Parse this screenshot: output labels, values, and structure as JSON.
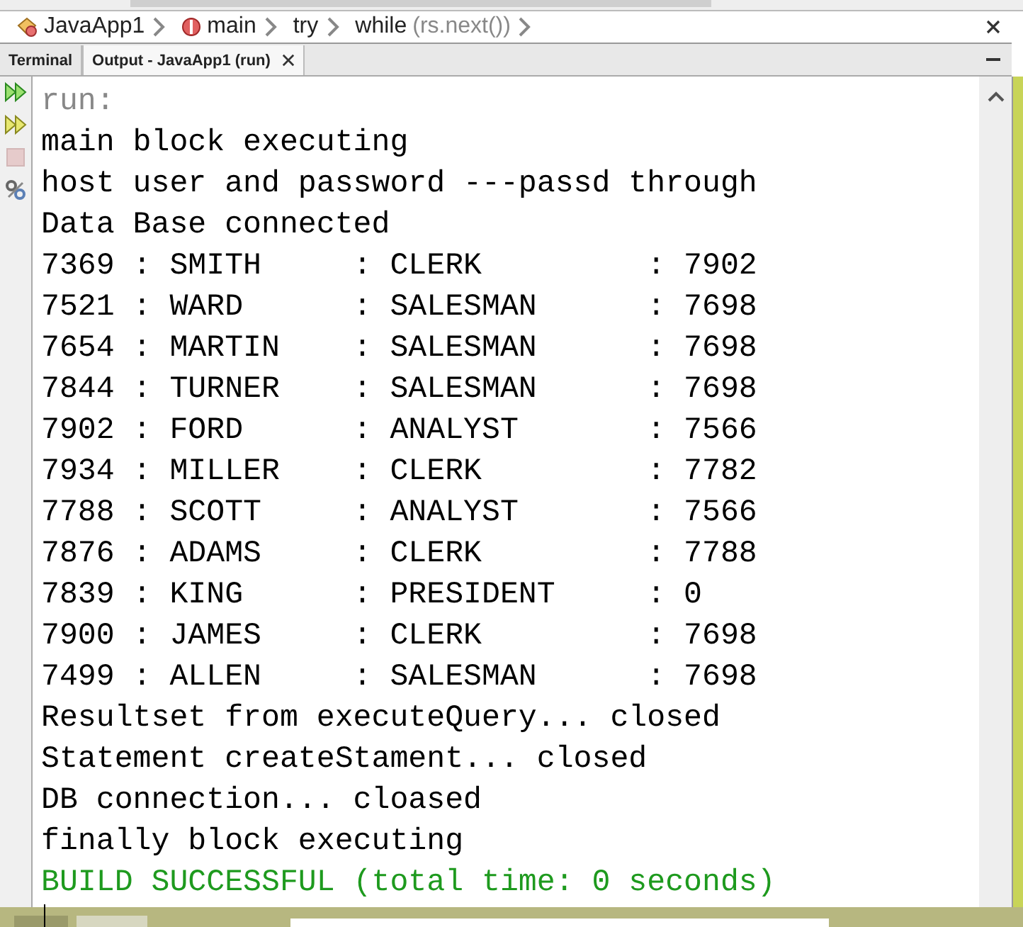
{
  "breadcrumbs": [
    {
      "kind": "project",
      "label": "JavaApp1"
    },
    {
      "kind": "method",
      "label": "main"
    },
    {
      "kind": "plain",
      "label": "try"
    },
    {
      "kind": "plain",
      "label": "while",
      "detail": "(rs.next())"
    }
  ],
  "tabs": [
    {
      "label": "Terminal",
      "selected": false,
      "closable": false
    },
    {
      "label": "Output - JavaApp1 (run)",
      "selected": true,
      "closable": true
    }
  ],
  "tools": [
    {
      "kind": "rerun",
      "disabled": false
    },
    {
      "kind": "rerun-with",
      "disabled": false
    },
    {
      "kind": "stop",
      "disabled": true
    },
    {
      "kind": "settings",
      "disabled": false
    }
  ],
  "output": [
    {
      "kind": "prompt",
      "text": "run:"
    },
    {
      "kind": "normal",
      "text": "main block executing"
    },
    {
      "kind": "normal",
      "text": "host user and password ---passd through"
    },
    {
      "kind": "normal",
      "text": "Data Base connected"
    },
    {
      "kind": "normal",
      "text": "7369 : SMITH     : CLERK         : 7902"
    },
    {
      "kind": "normal",
      "text": "7521 : WARD      : SALESMAN      : 7698"
    },
    {
      "kind": "normal",
      "text": "7654 : MARTIN    : SALESMAN      : 7698"
    },
    {
      "kind": "normal",
      "text": "7844 : TURNER    : SALESMAN      : 7698"
    },
    {
      "kind": "normal",
      "text": "7902 : FORD      : ANALYST       : 7566"
    },
    {
      "kind": "normal",
      "text": "7934 : MILLER    : CLERK         : 7782"
    },
    {
      "kind": "normal",
      "text": "7788 : SCOTT     : ANALYST       : 7566"
    },
    {
      "kind": "normal",
      "text": "7876 : ADAMS     : CLERK         : 7788"
    },
    {
      "kind": "normal",
      "text": "7839 : KING      : PRESIDENT     : 0"
    },
    {
      "kind": "normal",
      "text": "7900 : JAMES     : CLERK         : 7698"
    },
    {
      "kind": "normal",
      "text": "7499 : ALLEN     : SALESMAN      : 7698"
    },
    {
      "kind": "normal",
      "text": "Resultset from executeQuery... closed"
    },
    {
      "kind": "normal",
      "text": "Statement createStament... closed"
    },
    {
      "kind": "normal",
      "text": "DB connection... cloased"
    },
    {
      "kind": "normal",
      "text": "finally block executing"
    },
    {
      "kind": "success",
      "text": "BUILD SUCCESSFUL (total time: 0 seconds)"
    }
  ]
}
